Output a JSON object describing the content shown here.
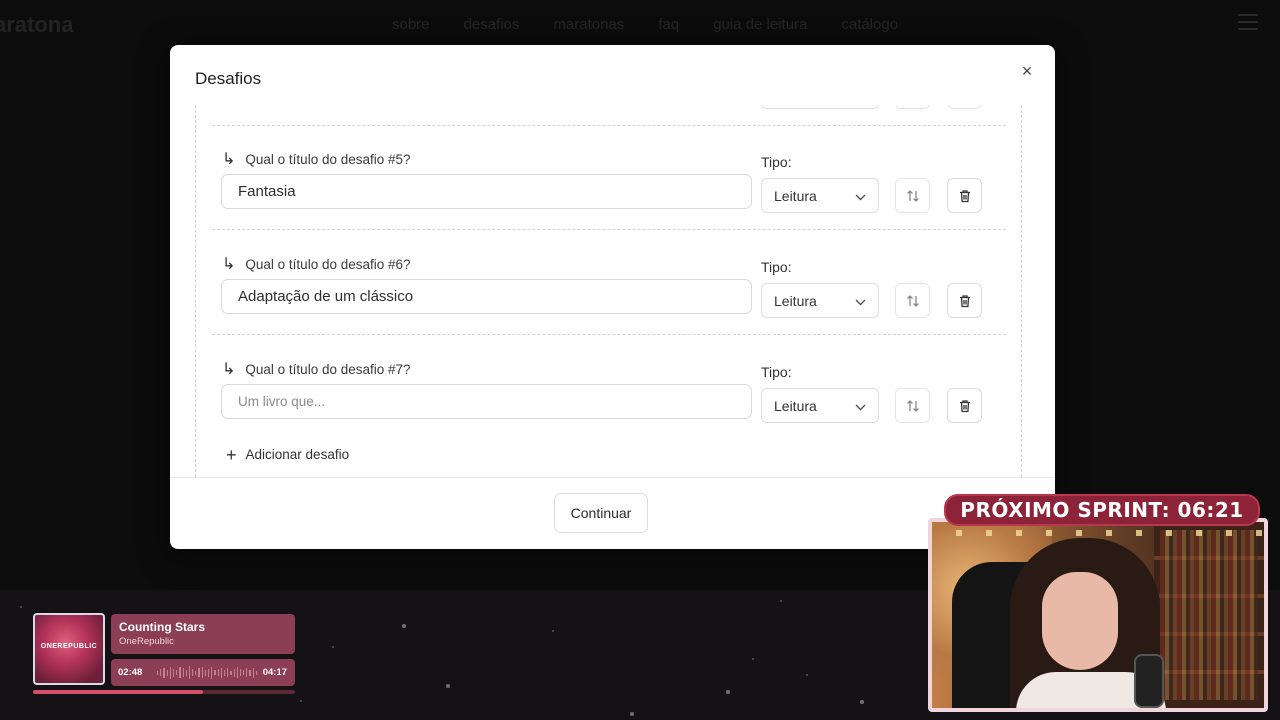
{
  "background": {
    "logo": "aratona",
    "nav_links": [
      "sobre",
      "desafios",
      "maratonas",
      "faq",
      "guia de leitura",
      "catálogo"
    ]
  },
  "modal": {
    "title": "Desafios",
    "close_icon": "×",
    "challenges": [
      {
        "label": "Qual o título do desafio #5?",
        "value": "Fantasia",
        "placeholder": "",
        "tipo_label": "Tipo:",
        "tipo_value": "Leitura"
      },
      {
        "label": "Qual o título do desafio #6?",
        "value": "Adaptação de um clássico",
        "placeholder": "",
        "tipo_label": "Tipo:",
        "tipo_value": "Leitura"
      },
      {
        "label": "Qual o título do desafio #7?",
        "value": "",
        "placeholder": "Um livro que...",
        "tipo_label": "Tipo:",
        "tipo_value": "Leitura"
      }
    ],
    "add_label": "Adicionar desafio",
    "continue_label": "Continuar"
  },
  "music": {
    "album_text": "ONEREPUBLIC",
    "title": "Counting Stars",
    "artist": "OneRepublic",
    "current_time": "02:48",
    "total_time": "04:17",
    "progress": 0.65
  },
  "stream": {
    "sprint_label": "PRÓXIMO SPRINT: 06:21"
  },
  "colors": {
    "music_bg": "#8b3e55",
    "progress_fill": "#d64f6c",
    "sprint_bg": "#8c2339"
  }
}
